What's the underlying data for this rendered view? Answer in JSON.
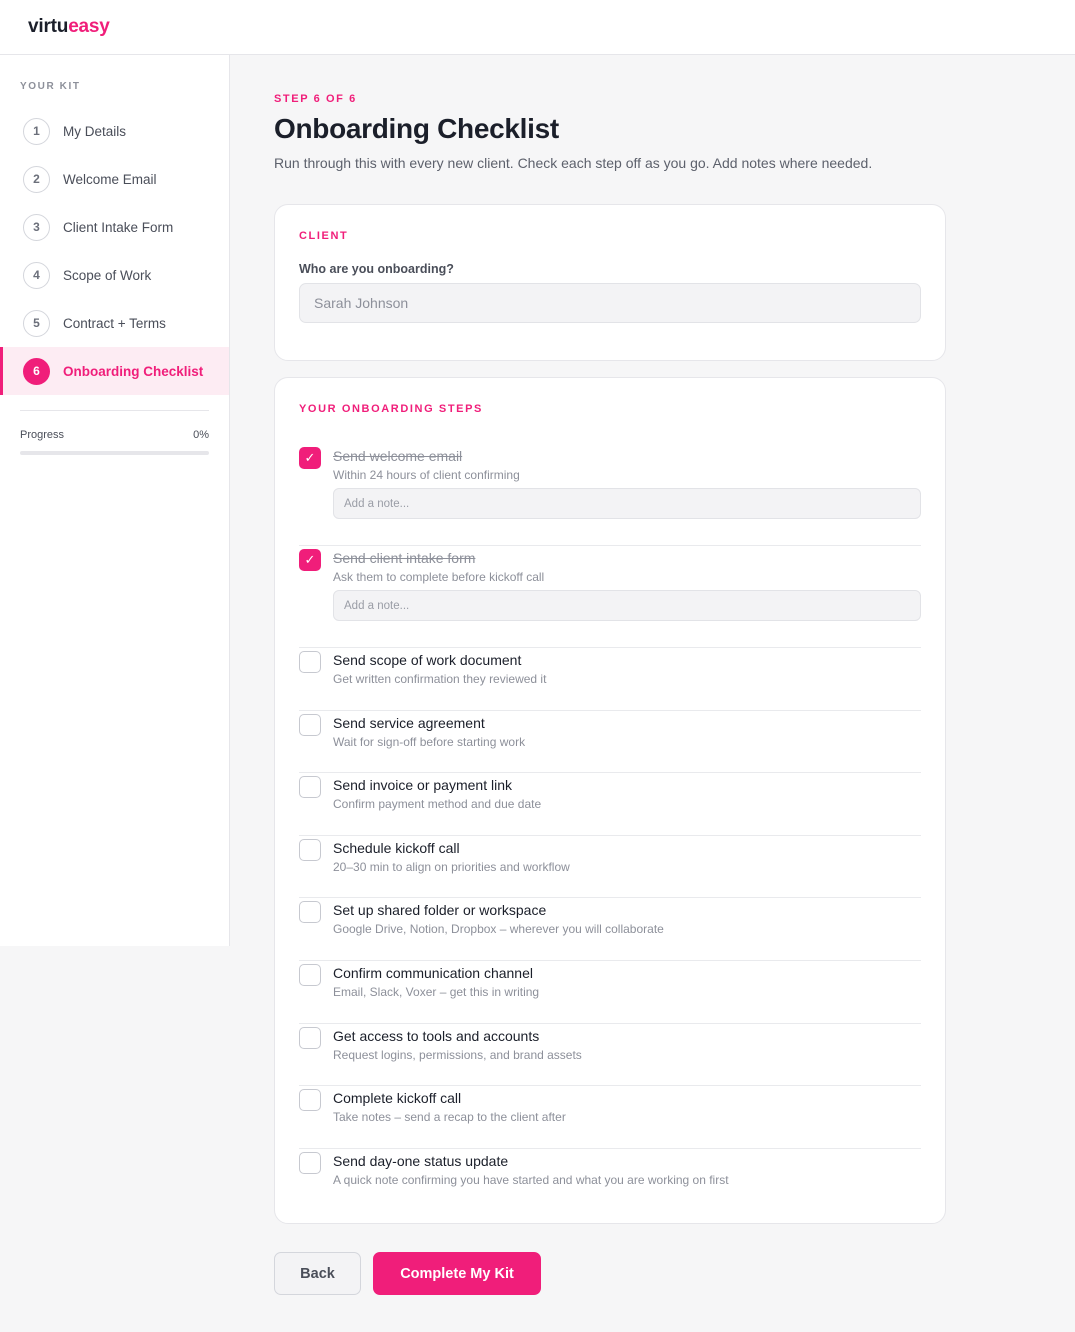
{
  "brand": {
    "logo_part1": "virtu",
    "logo_part2": "easy"
  },
  "sidebar": {
    "title": "YOUR KIT",
    "items": [
      {
        "number": "1",
        "label": "My Details",
        "active": false
      },
      {
        "number": "2",
        "label": "Welcome Email",
        "active": false
      },
      {
        "number": "3",
        "label": "Client Intake Form",
        "active": false
      },
      {
        "number": "4",
        "label": "Scope of Work",
        "active": false
      },
      {
        "number": "5",
        "label": "Contract + Terms",
        "active": false
      },
      {
        "number": "6",
        "label": "Onboarding Checklist",
        "active": true
      }
    ],
    "progress_label": "Progress",
    "progress_value": "0%",
    "progress_fraction": 0
  },
  "header": {
    "step_label": "STEP 6 OF 6",
    "title": "Onboarding Checklist",
    "subtitle": "Run through this with every new client. Check each step off as you go. Add notes where needed."
  },
  "client_section": {
    "label": "CLIENT",
    "question": "Who are you onboarding?",
    "placeholder": "Sarah Johnson",
    "value": ""
  },
  "steps_section": {
    "label": "YOUR ONBOARDING STEPS",
    "note_placeholder": "Add a note...",
    "tasks": [
      {
        "title": "Send welcome email",
        "description": "Within 24 hours of client confirming",
        "checked": true
      },
      {
        "title": "Send client intake form",
        "description": "Ask them to complete before kickoff call",
        "checked": true
      },
      {
        "title": "Send scope of work document",
        "description": "Get written confirmation they reviewed it",
        "checked": false
      },
      {
        "title": "Send service agreement",
        "description": "Wait for sign-off before starting work",
        "checked": false
      },
      {
        "title": "Send invoice or payment link",
        "description": "Confirm payment method and due date",
        "checked": false
      },
      {
        "title": "Schedule kickoff call",
        "description": "20–30 min to align on priorities and workflow",
        "checked": false
      },
      {
        "title": "Set up shared folder or workspace",
        "description": "Google Drive, Notion, Dropbox – wherever you will collaborate",
        "checked": false
      },
      {
        "title": "Confirm communication channel",
        "description": "Email, Slack, Voxer – get this in writing",
        "checked": false
      },
      {
        "title": "Get access to tools and accounts",
        "description": "Request logins, permissions, and brand assets",
        "checked": false
      },
      {
        "title": "Complete kickoff call",
        "description": "Take notes – send a recap to the client after",
        "checked": false
      },
      {
        "title": "Send day-one status update",
        "description": "A quick note confirming you have started and what you are working on first",
        "checked": false
      }
    ]
  },
  "actions": {
    "back_label": "Back",
    "complete_label": "Complete My Kit"
  },
  "colors": {
    "accent": "#f01e7a",
    "text": "#1b1f2a",
    "muted": "#8d909a"
  }
}
